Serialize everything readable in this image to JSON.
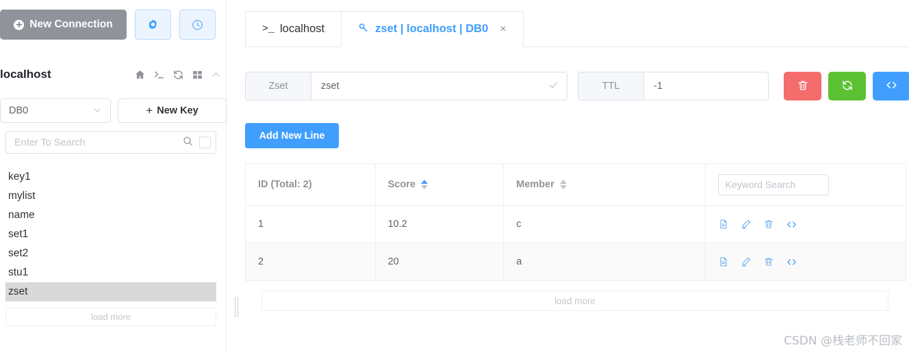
{
  "sidebar": {
    "new_connection_label": "New Connection",
    "settings_icon": "gear-icon",
    "history_icon": "clock-icon",
    "host_name": "localhost",
    "host_icons": [
      "home-icon",
      "terminal-icon",
      "refresh-icon",
      "grid-icon",
      "chevron-up-icon"
    ],
    "db_selected": "DB0",
    "new_key_label": "New Key",
    "new_key_plus": "+",
    "search_placeholder": "Enter To Search",
    "search_value": "",
    "keys": [
      {
        "name": "key1",
        "selected": false
      },
      {
        "name": "mylist",
        "selected": false
      },
      {
        "name": "name",
        "selected": false
      },
      {
        "name": "set1",
        "selected": false
      },
      {
        "name": "set2",
        "selected": false
      },
      {
        "name": "stu1",
        "selected": false
      },
      {
        "name": "zset",
        "selected": true
      }
    ],
    "load_more_label": "load more"
  },
  "tabs": [
    {
      "label": "localhost",
      "prefix": ">_",
      "active": false,
      "closable": false
    },
    {
      "label": "zset | localhost | DB0",
      "prefix": "",
      "active": true,
      "closable": true,
      "close_label": "×"
    }
  ],
  "key_editor": {
    "type_label": "Zset",
    "key_value": "zset",
    "key_confirm_icon": "check-icon",
    "ttl_label": "TTL",
    "ttl_value": "-1",
    "ttl_clear_icon": "close-icon",
    "ttl_confirm_icon": "check-icon",
    "delete_icon": "trash-icon",
    "refresh_icon": "refresh-icon",
    "code_icon": "code-icon",
    "delete_color": "#f56c6c",
    "refresh_color": "#5cc233",
    "code_color": "#409eff"
  },
  "toolbar": {
    "add_new_line_label": "Add New Line",
    "add_new_line_color": "#409eff"
  },
  "table": {
    "columns": [
      {
        "label": "ID (Total: 2)",
        "sortable": false
      },
      {
        "label": "Score",
        "sortable": true,
        "sort": "asc"
      },
      {
        "label": "Member",
        "sortable": true,
        "sort": "none"
      },
      {
        "label": "",
        "sortable": false
      }
    ],
    "keyword_placeholder": "Keyword Search",
    "keyword_value": "",
    "rows": [
      {
        "id": "1",
        "score": "10.2",
        "member": "c"
      },
      {
        "id": "2",
        "score": "20",
        "member": "a"
      }
    ],
    "row_action_icons": [
      "document-icon",
      "edit-icon",
      "trash-icon",
      "code-icon"
    ],
    "load_more_label": "load more"
  },
  "watermark": "CSDN @栈老师不回家"
}
